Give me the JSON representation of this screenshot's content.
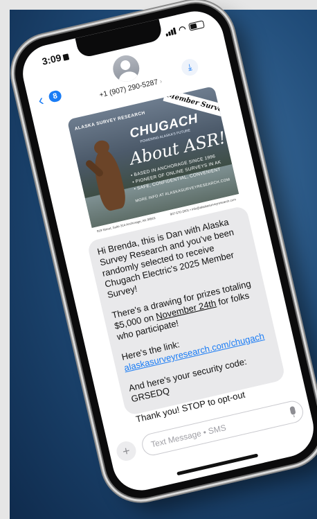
{
  "status": {
    "time": "3:09"
  },
  "header": {
    "back_count": "8",
    "contact": "+1 (907) 290-5287"
  },
  "promo": {
    "ribbon": "Member Survey",
    "asr_logo": "ALASKA SURVEY RESEARCH",
    "brand": "CHUGACH",
    "tagline": "POWERING ALASKA'S FUTURE",
    "headline": "About ASR!",
    "bullets": [
      "• BASED IN ANCHORAGE SINCE 1996",
      "• PIONEER OF ONLINE SURVEYS IN AK",
      "• SAFE, CONFIDENTIAL, CONVENIENT"
    ],
    "more_info": "MORE INFO AT ALASKASURVEYRESEARCH.COM",
    "footer_left": "919 Street, Suite 314 Anchorage, AK 99501",
    "footer_right": "907-570-2001 • info@alaskasurveyresearch.com"
  },
  "message": {
    "p1": "Hi Brenda, this is Dan with Alaska Survey Research and you've been randomly selected to receive Chugach Electric's 2025 Member Survey!",
    "p2_before": "There's a drawing for prizes totaling $5,000 on ",
    "p2_date": "November 24th",
    "p2_after": " for folks who participate!",
    "p3_label": "Here's the link:",
    "p3_link": "alaskasurveyresearch.com/chugach",
    "p4_label": "And here's your security code:",
    "p4_code": "GRSEDQ",
    "p5": "Thank you! STOP to opt-out"
  },
  "composer": {
    "placeholder": "Text Message • SMS",
    "plus": "+"
  },
  "colors": {
    "accent": "#1a7cf5",
    "bubble": "#e9e9eb",
    "backdrop": "#1f4b78"
  }
}
